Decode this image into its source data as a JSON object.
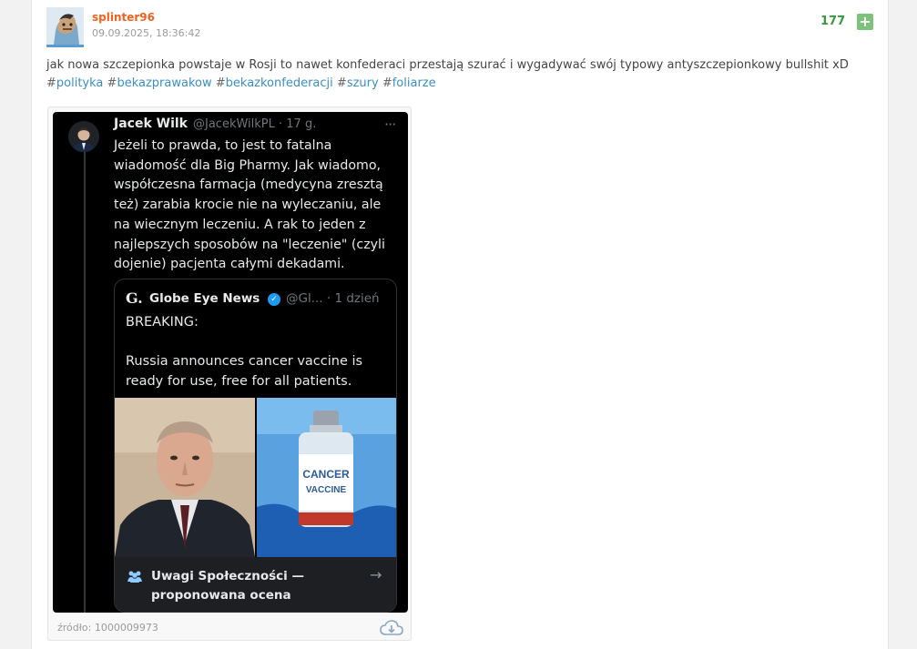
{
  "post": {
    "author": "splinter96",
    "date": "09.09.2025, 18:36:42",
    "votes": "177",
    "plus_label": "+",
    "body": "jak nowa szczepionka powstaje w Rosji to nawet konfederaci przestają szurać i wygadywać swój typowy antyszczepionkowy bullshit xD",
    "tags": [
      "polityka",
      "bekazprawakow",
      "bekazkonfederacji",
      "szury",
      "foliarze"
    ],
    "hash": "#"
  },
  "embed": {
    "tweet": {
      "name": "Jacek Wilk",
      "handle": "@JacekWilkPL · 17 g.",
      "menu": "···",
      "lines": [
        "Jeżeli to prawda, to jest to fatalna",
        "wiadomość dla Big Pharmy. Jak wiadomo,",
        "współczesna farmacja (medycyna zresztą",
        "też) zarabia krocie nie na wyleczaniu, ale",
        "na wiecznym leczeniu. A rak to jeden z",
        "najlepszych sposobów na \"leczenie\" (czyli",
        "dojenie) pacjenta całymi dekadami."
      ]
    },
    "quote": {
      "logo": "G.",
      "name": "Globe Eye News",
      "verified_icon": "verified-badge-icon",
      "handle": "@Gl... · 1 dzień",
      "body": "BREAKING:\n\nRussia announces cancer vaccine is\nready for use, free for all patients.",
      "vial_text_1": "CANCER",
      "vial_text_2": "VACCINE"
    },
    "note": {
      "icon": "community-icon",
      "text_1": "Uwagi Społeczności —",
      "text_2": "proponowana ocena",
      "arrow": "→"
    },
    "source": "źródło: 1000009973",
    "download_icon": "cloud-download-icon"
  },
  "colors": {
    "author": "#f0621f",
    "votes": "#3a9a3a",
    "tag": "#3b8fc4",
    "plus_bg": "#7dc27a"
  }
}
